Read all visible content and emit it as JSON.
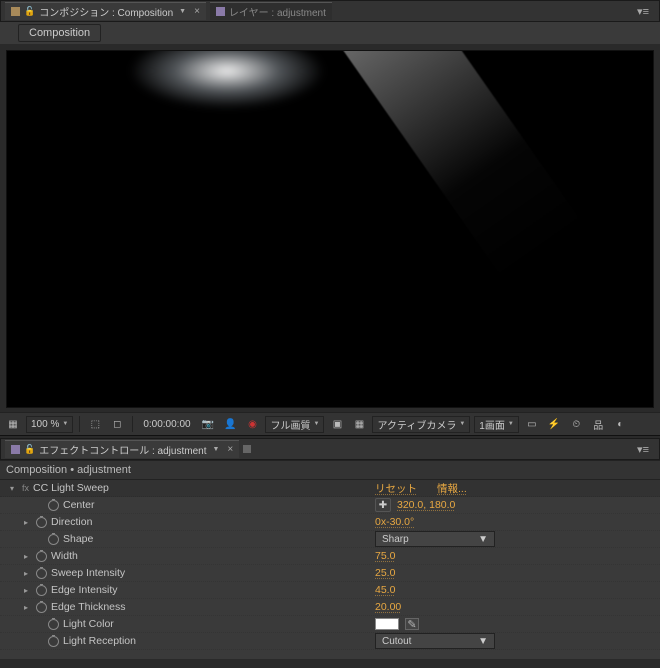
{
  "tabs": {
    "compositionTab": "コンポジション : Composition",
    "layerTab": "レイヤー : adjustment",
    "subTab": "Composition"
  },
  "viewer_toolbar": {
    "zoom": "100 %",
    "timecode": "0:00:00:00",
    "quality": "フル画質",
    "camera": "アクティブカメラ",
    "view": "1画面"
  },
  "effects_tab": "エフェクトコントロール : adjustment",
  "breadcrumb": "Composition • adjustment",
  "effect_name": "CC Light Sweep",
  "top_links": {
    "reset": "リセット",
    "about": "情報..."
  },
  "props": {
    "center": {
      "label": "Center",
      "value": "320.0, 180.0"
    },
    "direction": {
      "label": "Direction",
      "value": "0x-30.0°"
    },
    "shape": {
      "label": "Shape",
      "value": "Sharp"
    },
    "width": {
      "label": "Width",
      "value": "75.0"
    },
    "sweepInt": {
      "label": "Sweep Intensity",
      "value": "25.0"
    },
    "edgeInt": {
      "label": "Edge Intensity",
      "value": "45.0"
    },
    "edgeThick": {
      "label": "Edge Thickness",
      "value": "20.00"
    },
    "lightColor": {
      "label": "Light Color",
      "value": "#ffffff"
    },
    "lightRecept": {
      "label": "Light Reception",
      "value": "Cutout"
    }
  }
}
